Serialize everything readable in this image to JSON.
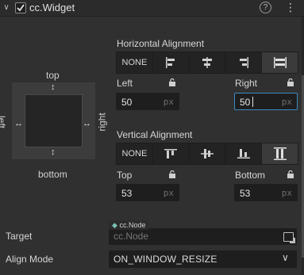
{
  "component": {
    "title": "cc.Widget",
    "enabled": true
  },
  "diagram": {
    "top": "top",
    "bottom": "bottom",
    "left": "left",
    "right": "right"
  },
  "horizontal": {
    "title": "Horizontal Alignment",
    "none_label": "NONE",
    "selected": "stretch",
    "left_label": "Left",
    "right_label": "Right",
    "left_value": "50",
    "right_value": "50",
    "unit": "px"
  },
  "vertical": {
    "title": "Vertical Alignment",
    "none_label": "NONE",
    "selected": "stretch",
    "top_label": "Top",
    "bottom_label": "Bottom",
    "top_value": "53",
    "bottom_value": "53",
    "unit": "px"
  },
  "target": {
    "label": "Target",
    "type_tag": "cc.Node",
    "placeholder": "cc.Node"
  },
  "align_mode": {
    "label": "Align Mode",
    "value": "ON_WINDOW_RESIZE"
  },
  "icons": {
    "collapse": "chevron-down-icon",
    "help": "help-icon",
    "menu": "more-vertical-icon",
    "lock": "lock-open-icon",
    "pick": "pick-node-icon"
  },
  "colors": {
    "accent_focus": "#3a8bbd",
    "node_diamond": "#7bc2b5"
  }
}
